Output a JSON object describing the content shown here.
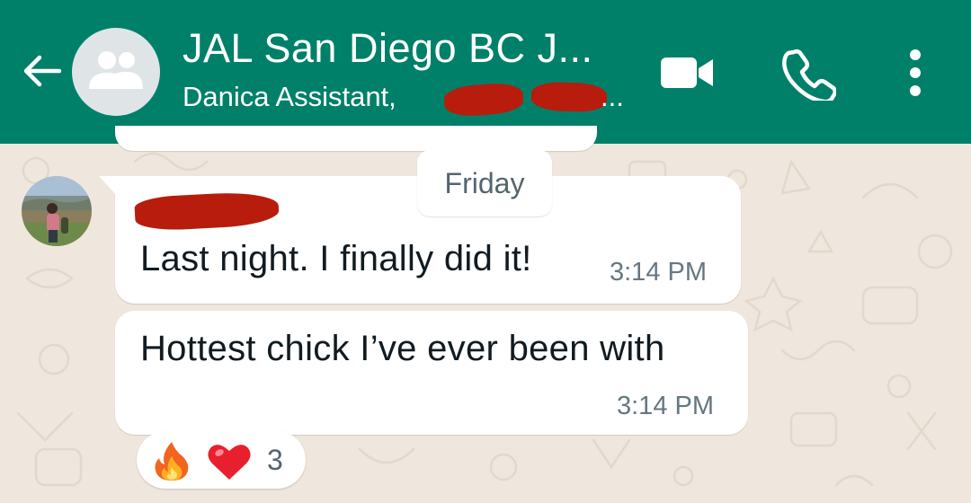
{
  "header": {
    "title": "JAL San Diego BC J...",
    "subtitle_prefix": "Danica Assistant,",
    "subtitle_ellipsis": "...",
    "icons": {
      "back": "arrow-left-icon",
      "avatar": "group-icon",
      "video": "video-camera-icon",
      "call": "phone-icon",
      "menu": "more-vertical-icon"
    }
  },
  "chat": {
    "date_divider": "Friday",
    "messages": [
      {
        "sender": "redacted",
        "text": "Last night. I finally did it!",
        "time": "3:14 PM"
      },
      {
        "text": "Hottest chick I’ve ever been with",
        "time": "3:14 PM"
      }
    ],
    "reactions": {
      "emojis": [
        "fire-icon",
        "heart-icon"
      ],
      "count": "3"
    }
  },
  "colors": {
    "header_bg": "#008069",
    "wallpaper": "#efe7dd",
    "bubble": "#ffffff",
    "timestamp": "#667781",
    "redaction": "#b81c0c"
  }
}
